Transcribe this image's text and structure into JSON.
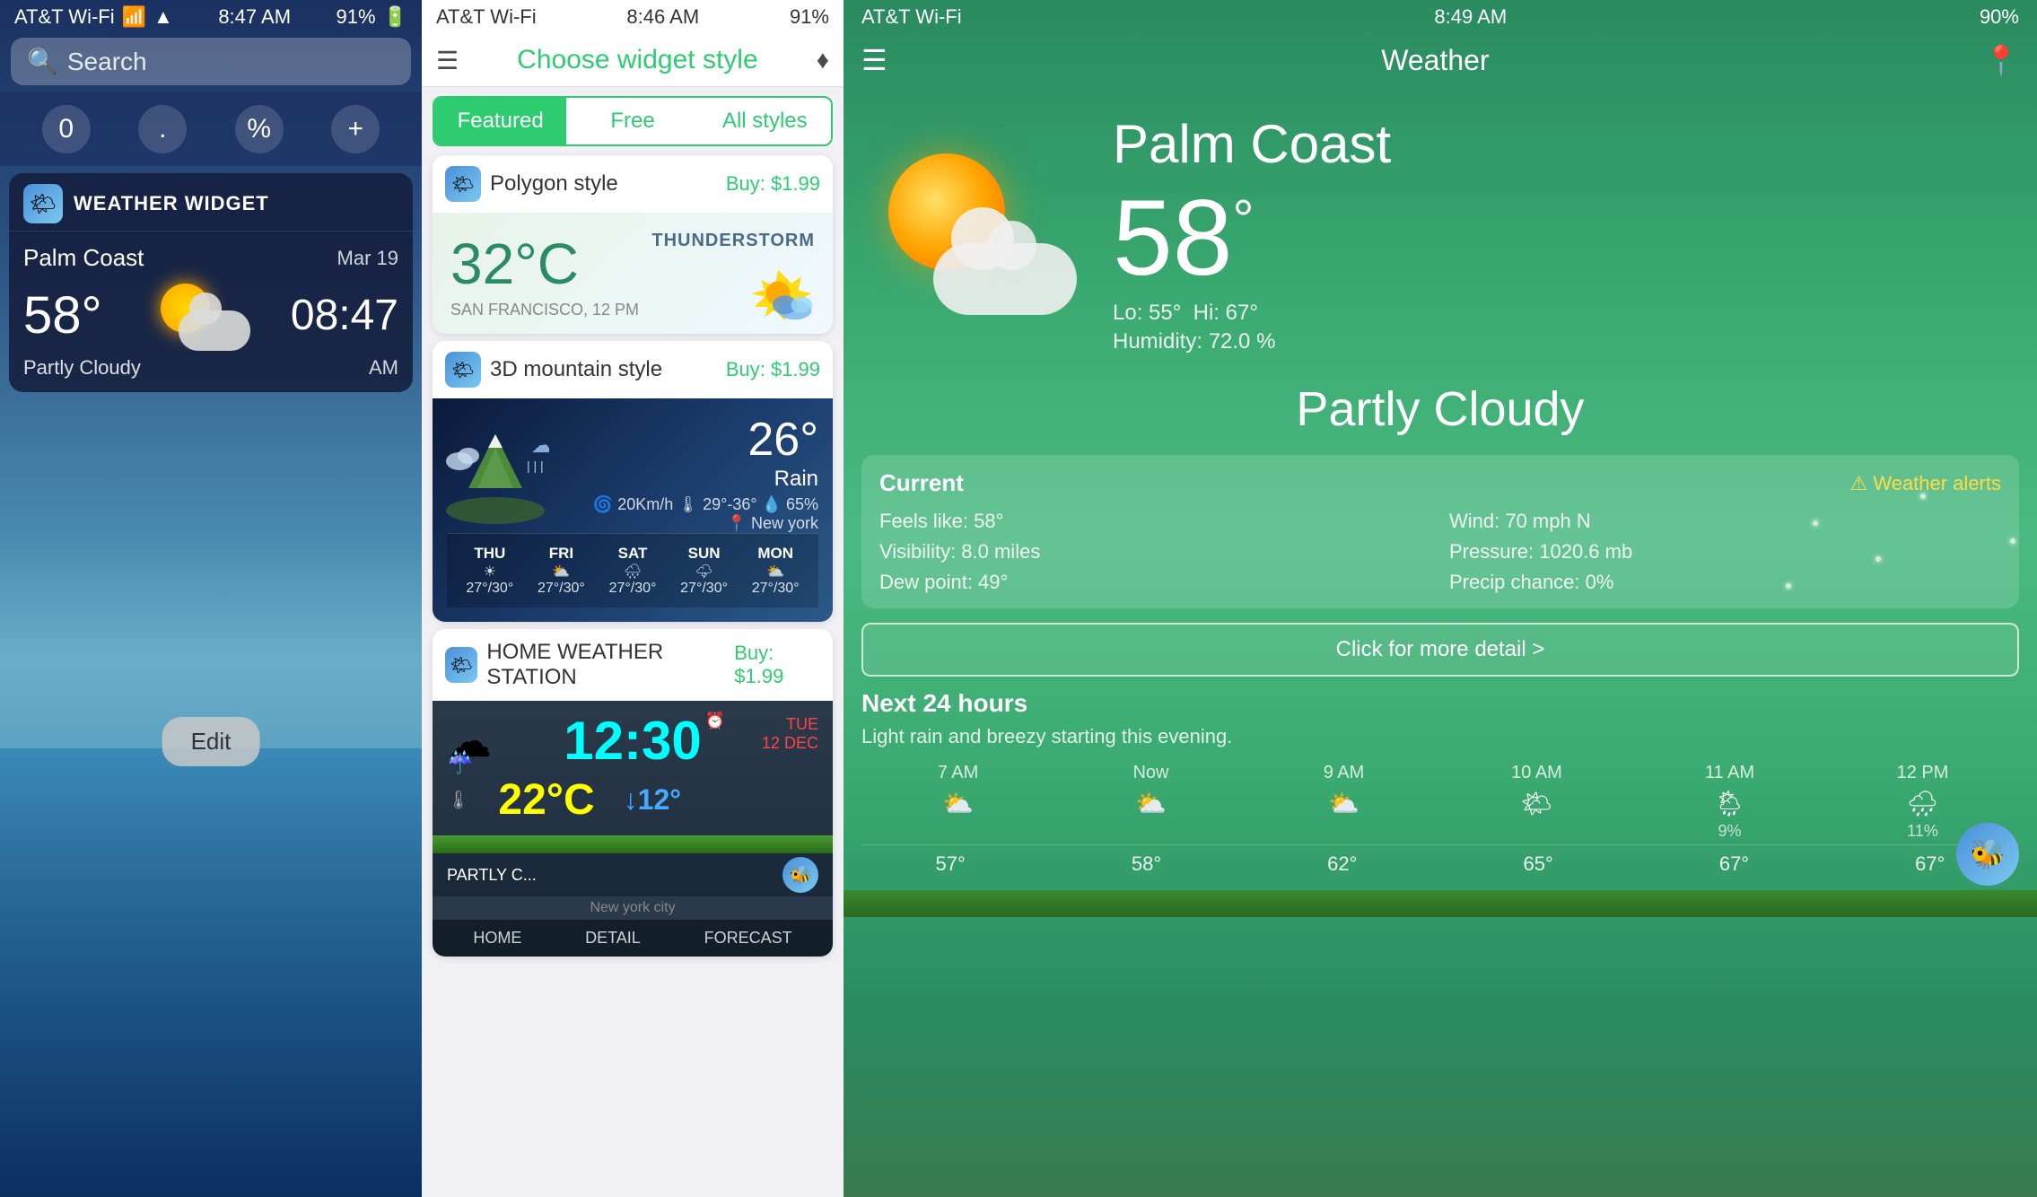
{
  "panel1": {
    "status": {
      "carrier": "AT&T Wi-Fi",
      "time": "8:47 AM",
      "battery": "91%",
      "signal": "▲"
    },
    "search": {
      "placeholder": "Search"
    },
    "calculator": {
      "buttons": [
        "0",
        ".",
        "%",
        "+"
      ]
    },
    "widget": {
      "title": "WEATHER WIDGET",
      "location": "Palm Coast",
      "date": "Mar 19",
      "temperature": "58°",
      "time": "08:47",
      "condition": "Partly Cloudy",
      "ampm": "AM"
    },
    "edit_button": "Edit"
  },
  "panel2": {
    "status": {
      "carrier": "AT&T Wi-Fi",
      "time": "8:46 AM",
      "battery": "91%"
    },
    "header": {
      "title": "Choose widget style"
    },
    "tabs": [
      {
        "label": "Featured",
        "active": true
      },
      {
        "label": "Free",
        "active": false
      },
      {
        "label": "All styles",
        "active": false
      }
    ],
    "cards": [
      {
        "title": "Polygon style",
        "price": "Buy: $1.99",
        "preview": {
          "temperature": "32°C",
          "condition": "THUNDERSTORM",
          "location": "SAN FRANCISCO, 12 PM"
        }
      },
      {
        "title": "3D mountain style",
        "price": "Buy: $1.99",
        "preview": {
          "temperature": "26°",
          "condition": "Rain",
          "details1": "🌀 20Km/h  🌡 29°-36°  💧 65%",
          "location": "📍 New york",
          "forecast": [
            {
              "day": "THU",
              "temp": "27°/30°"
            },
            {
              "day": "FRI",
              "temp": "27°/30°"
            },
            {
              "day": "SAT",
              "temp": "27°/30°"
            },
            {
              "day": "SUN",
              "temp": "27°/30°"
            },
            {
              "day": "MON",
              "temp": "27°/30°"
            }
          ]
        }
      },
      {
        "title": "HOME WEATHER STATION",
        "price": "Buy: $1.99",
        "preview": {
          "time": "12:30",
          "date": "TUE\n12 DEC",
          "temperature": "22°C",
          "down_temp": "↓12°",
          "condition": "PARTLY C...",
          "location": "New york city"
        },
        "nav": [
          "HOME",
          "DETAIL",
          "FORECAST"
        ]
      }
    ]
  },
  "panel3": {
    "status": {
      "carrier": "AT&T Wi-Fi",
      "time": "8:49 AM",
      "battery": "90%",
      "signal": "▲"
    },
    "header": {
      "title": "Weather"
    },
    "weather": {
      "city": "Palm Coast",
      "temperature": "58",
      "degree_symbol": "°",
      "lo": "55°",
      "hi": "67°",
      "humidity": "72.0 %",
      "condition": "Partly Cloudy"
    },
    "current": {
      "title": "Current",
      "alerts_label": "⚠ Weather alerts",
      "feels_like": "Feels like: 58°",
      "visibility": "Visibility: 8.0 miles",
      "dew_point": "Dew point: 49°",
      "wind": "Wind: 70 mph N",
      "pressure": "Pressure: 1020.6 mb",
      "precip": "Precip chance: 0%"
    },
    "detail_button": "Click for more detail >",
    "next24": {
      "title": "Next 24 hours",
      "description": "Light rain and breezy starting this evening.",
      "hours": [
        {
          "label": "7 AM",
          "icon": "⛅",
          "percent": "",
          "temp": "57°"
        },
        {
          "label": "Now",
          "icon": "⛅",
          "percent": "",
          "temp": "58°"
        },
        {
          "label": "9 AM",
          "icon": "⛅",
          "percent": "",
          "temp": "62°"
        },
        {
          "label": "10 AM",
          "icon": "🌤",
          "percent": "",
          "temp": "65°"
        },
        {
          "label": "11 AM",
          "icon": "🌦",
          "percent": "9%",
          "temp": "67°"
        },
        {
          "label": "12 PM",
          "icon": "🌧",
          "percent": "11%",
          "temp": "67°"
        }
      ]
    }
  }
}
